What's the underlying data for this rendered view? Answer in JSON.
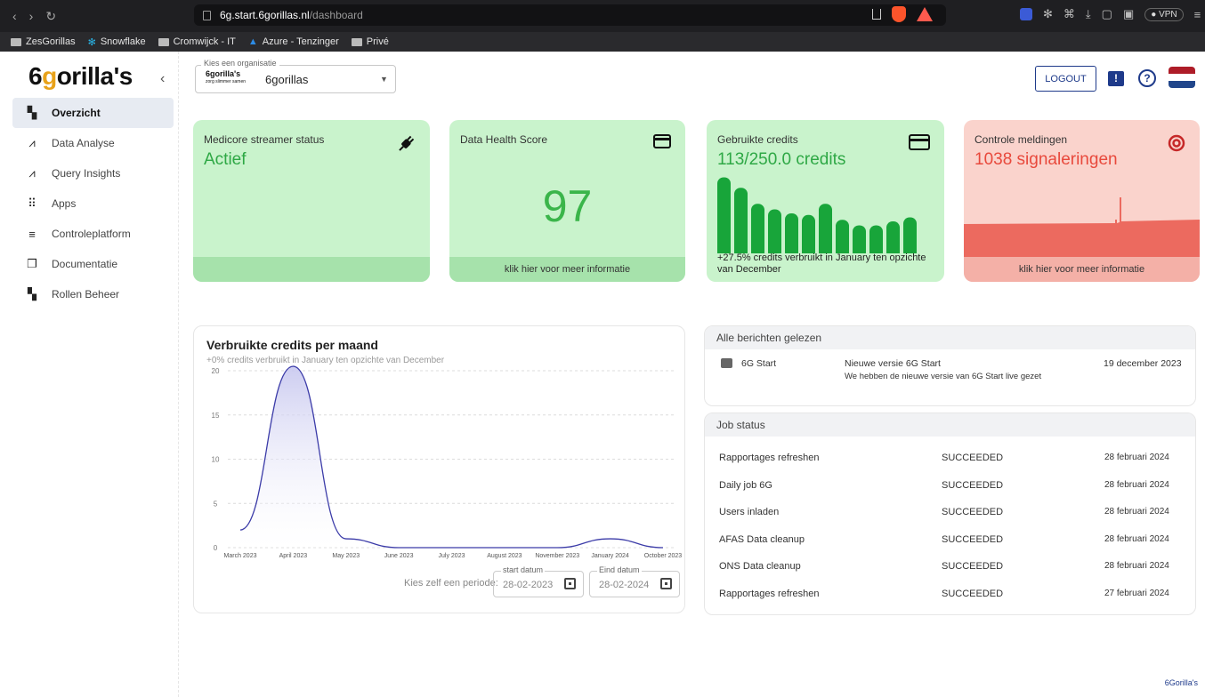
{
  "browser": {
    "nav": [
      "‹",
      "›",
      "↻"
    ],
    "url_host": "6g.start.6gorillas.nl",
    "url_path": "/dashboard",
    "vpn": "● VPN"
  },
  "bookmarks": [
    {
      "label": "ZesGorillas",
      "icon": "folder-icon"
    },
    {
      "label": "Snowflake",
      "icon": "snowflake-icon"
    },
    {
      "label": "Cromwijck - IT",
      "icon": "folder-icon"
    },
    {
      "label": "Azure - Tenzinger",
      "icon": "azure-icon"
    },
    {
      "label": "Privé",
      "icon": "folder-icon"
    }
  ],
  "brand": {
    "logo_pre": "6",
    "logo_plus": "g",
    "logo_post": "orilla's",
    "collapse": "‹"
  },
  "sidebar": {
    "items": [
      {
        "label": "Overzicht",
        "icon": "dashboard-icon",
        "glyph": "▚",
        "active": true
      },
      {
        "label": "Data Analyse",
        "icon": "chart-line-icon",
        "glyph": "⩘",
        "active": false
      },
      {
        "label": "Query Insights",
        "icon": "insights-icon",
        "glyph": "⩘",
        "active": false
      },
      {
        "label": "Apps",
        "icon": "grid-icon",
        "glyph": "⠿",
        "active": false
      },
      {
        "label": "Controleplatform",
        "icon": "checklist-icon",
        "glyph": "≡",
        "active": false
      },
      {
        "label": "Documentatie",
        "icon": "clipboard-icon",
        "glyph": "❐",
        "active": false
      },
      {
        "label": "Rollen Beheer",
        "icon": "roles-icon",
        "glyph": "▚",
        "active": false
      }
    ]
  },
  "org": {
    "legend": "Kies een organisatie",
    "logo_text": "6gorilla's",
    "logo_tagline": "zorg slimmer samen",
    "selected": "6gorillas",
    "caret": "▼"
  },
  "header": {
    "logout": "LOGOUT",
    "msg_glyph": "!",
    "help_glyph": "?"
  },
  "flag_colors": [
    "#ae1c28",
    "#ffffff",
    "#21468b"
  ],
  "cards": {
    "streamer": {
      "title": "Medicore streamer status",
      "value": "Actief",
      "icon": "plug-icon"
    },
    "health": {
      "title": "Data Health Score",
      "value": "97",
      "footer": "klik hier voor meer informatie",
      "icon": "card-icon"
    },
    "credits": {
      "title": "Gebruikte credits",
      "value": "113/250.0 credits",
      "note": "+27.5% credits verbruikt in January ten opzichte van December",
      "icon": "card-icon",
      "bar_levels": [
        0.95,
        0.82,
        0.62,
        0.55,
        0.5,
        0.48,
        0.62,
        0.42,
        0.35,
        0.35,
        0.4,
        0.45
      ]
    },
    "alerts": {
      "title": "Controle meldingen",
      "value": "1038 signaleringen",
      "footer": "klik hier voor meer informatie",
      "icon": "target-icon"
    }
  },
  "chart": {
    "title": "Verbruikte credits per maand",
    "subtitle": "+0% credits verbruikt in January ten opzichte van December",
    "period_label": "Kies zelf een periode:",
    "start_legend": "start datum",
    "start_value": "28-02-2023",
    "end_legend": "Eind datum",
    "end_value": "28-02-2024"
  },
  "chart_data": {
    "type": "area",
    "title": "Verbruikte credits per maand",
    "x": [
      "March 2023",
      "April 2023",
      "May 2023",
      "June 2023",
      "July 2023",
      "August 2023",
      "November 2023",
      "January 2024",
      "October 2023"
    ],
    "ylim": [
      0,
      20
    ],
    "yticks": [
      0,
      5,
      10,
      15,
      20
    ],
    "series": [
      {
        "values": [
          2,
          20.5,
          1,
          0,
          0,
          0,
          0,
          1,
          0
        ]
      }
    ],
    "grid": true,
    "color": "#3b3ba8"
  },
  "messages": {
    "header": "Alle berichten gelezen",
    "items": [
      {
        "sender": "6G Start",
        "subject": "Nieuwe versie 6G Start",
        "body": "We hebben de nieuwe versie van 6G Start live gezet",
        "date": "19 december 2023"
      }
    ]
  },
  "jobs": {
    "header": "Job status",
    "rows": [
      {
        "name": "Rapportages refreshen",
        "status": "SUCCEEDED",
        "date": "28 februari 2024"
      },
      {
        "name": "Daily job 6G",
        "status": "SUCCEEDED",
        "date": "28 februari 2024"
      },
      {
        "name": "Users inladen",
        "status": "SUCCEEDED",
        "date": "28 februari 2024"
      },
      {
        "name": "AFAS Data cleanup",
        "status": "SUCCEEDED",
        "date": "28 februari 2024"
      },
      {
        "name": "ONS Data cleanup",
        "status": "SUCCEEDED",
        "date": "28 februari 2024"
      },
      {
        "name": "Rapportages refreshen",
        "status": "SUCCEEDED",
        "date": "27 februari 2024"
      }
    ]
  },
  "footer": {
    "brand": "6Gorilla's"
  }
}
